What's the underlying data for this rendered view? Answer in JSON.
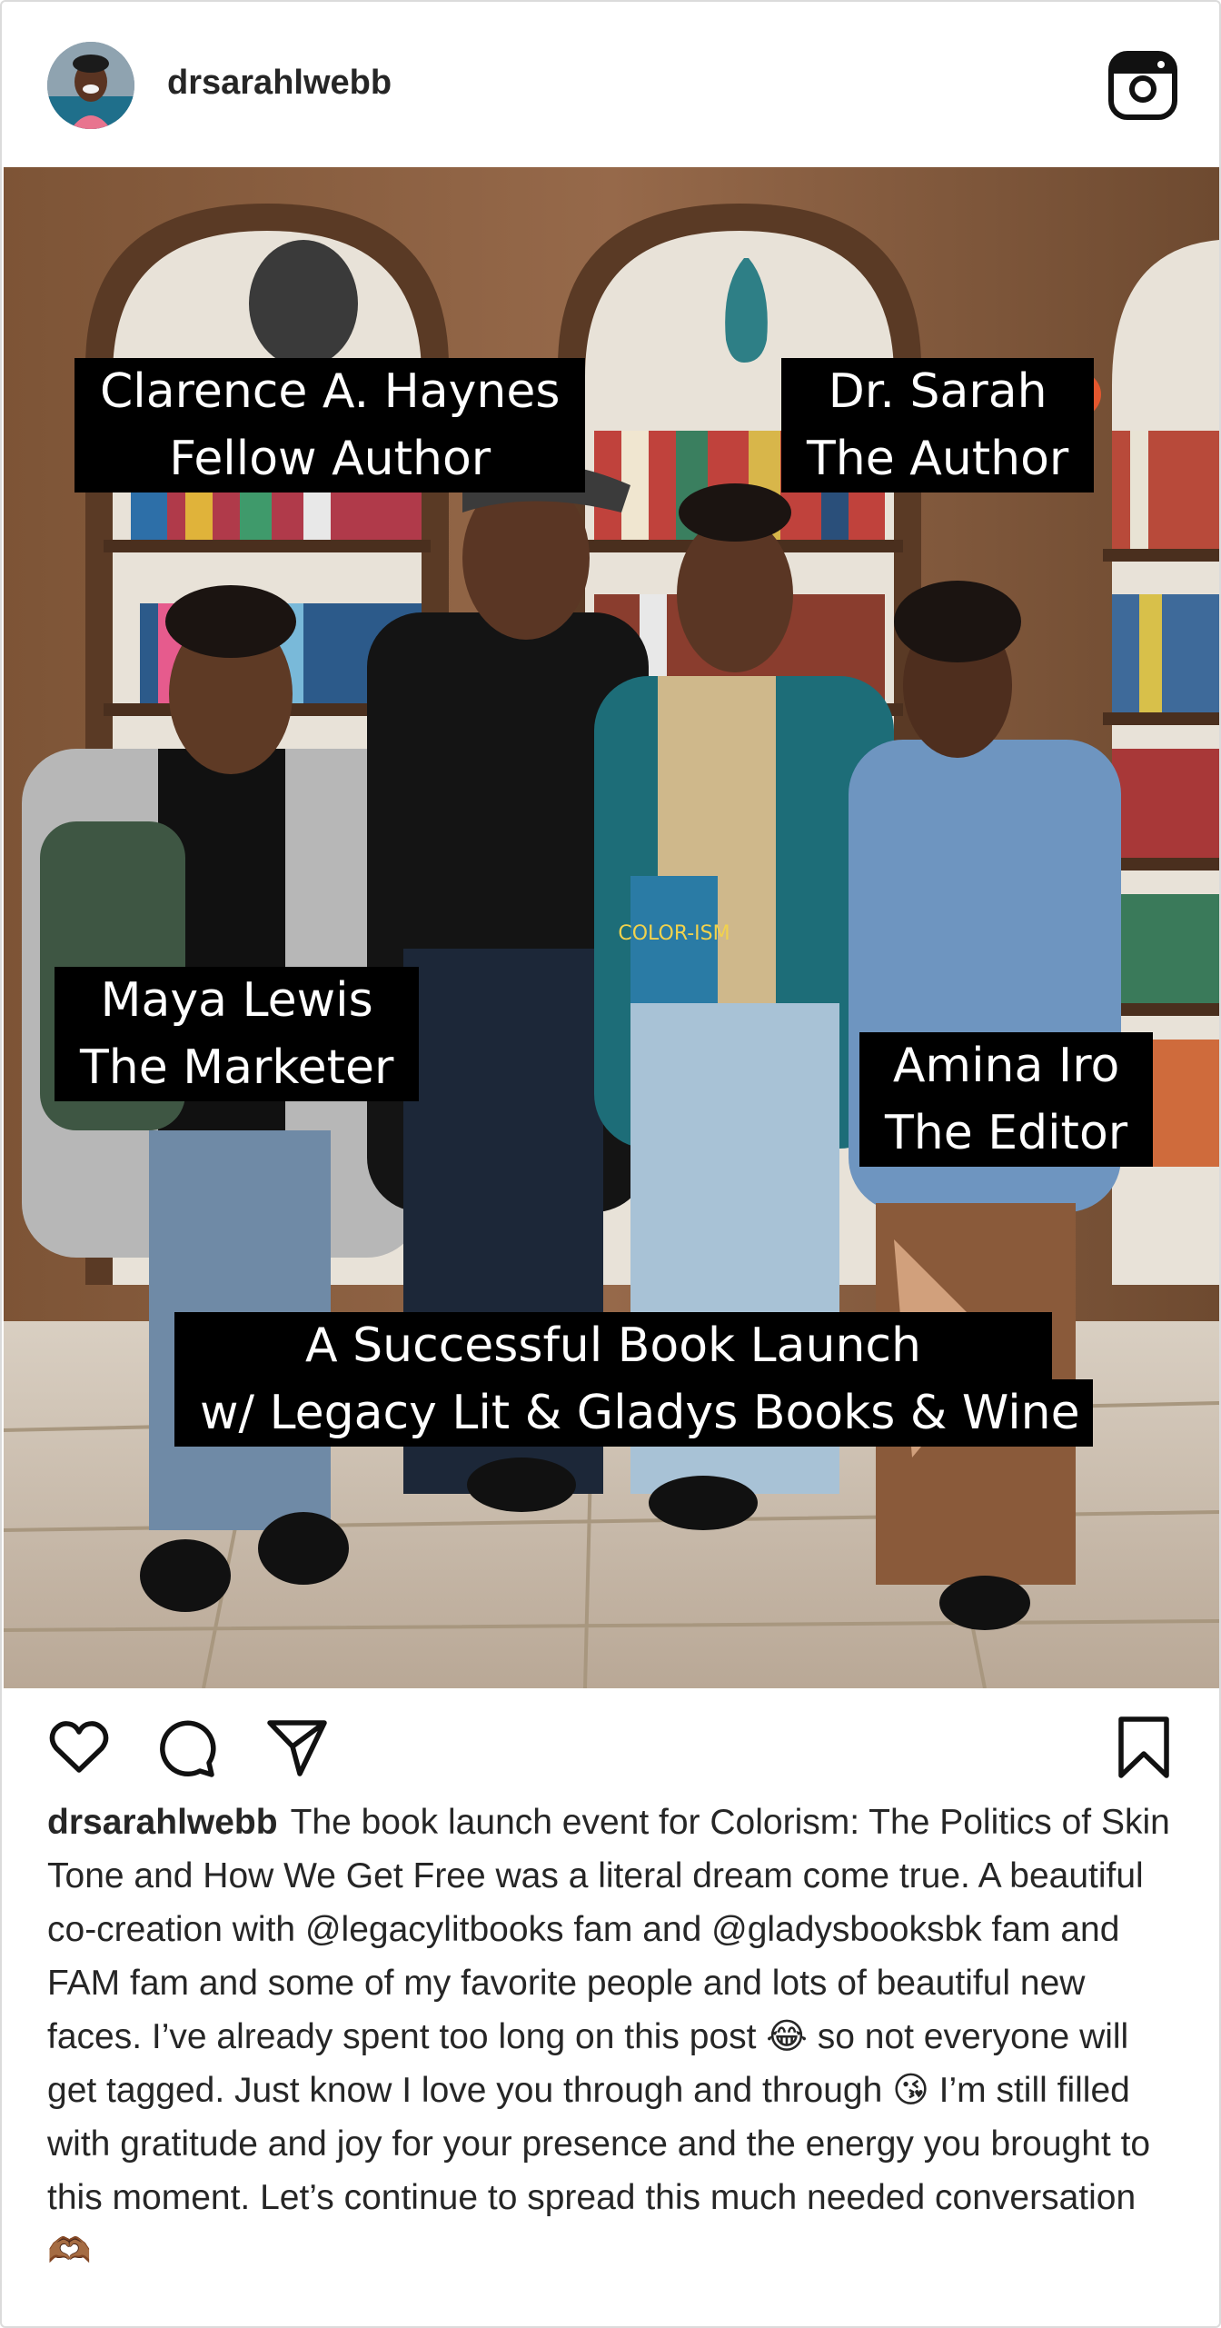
{
  "post": {
    "username": "drsarahlwebb",
    "photo_labels": {
      "clarence_name": "Clarence A. Haynes",
      "clarence_role": "Fellow Author",
      "sarah_name": "Dr. Sarah",
      "sarah_role": "The Author",
      "maya_name": "Maya Lewis",
      "maya_role": "The Marketer",
      "amina_name": "Amina Iro",
      "amina_role": "The Editor",
      "banner_line1": "A Successful Book Launch",
      "banner_line2": "w/ Legacy Lit & Gladys Books & Wine"
    },
    "book_cover_text": "COLOR-ISM",
    "caption": {
      "username": "drsarahlwebb",
      "text": "The book launch event for Colorism: The Politics of Skin Tone and How We Get Free was a literal dream come true. A beautiful co-creation with @legacylitbooks fam and @gladysbooksbk fam and FAM fam and some of my favorite people and lots of beautiful new faces. I’ve already spent too long on this post 😂 so not everyone will get tagged. Just know I love you through and through 😘 I’m still filled with gratitude and joy for your presence and the energy you brought to this moment. Let’s continue to spread this much needed conversation 🫶🏾"
    }
  },
  "icons": {
    "header_right": "instagram-icon",
    "like": "heart-icon",
    "comment": "comment-icon",
    "share": "send-icon",
    "save": "bookmark-icon"
  },
  "colors": {
    "text": "#262626",
    "border": "#dbdbdb",
    "label_bg": "#000000",
    "label_text": "#ffffff"
  }
}
